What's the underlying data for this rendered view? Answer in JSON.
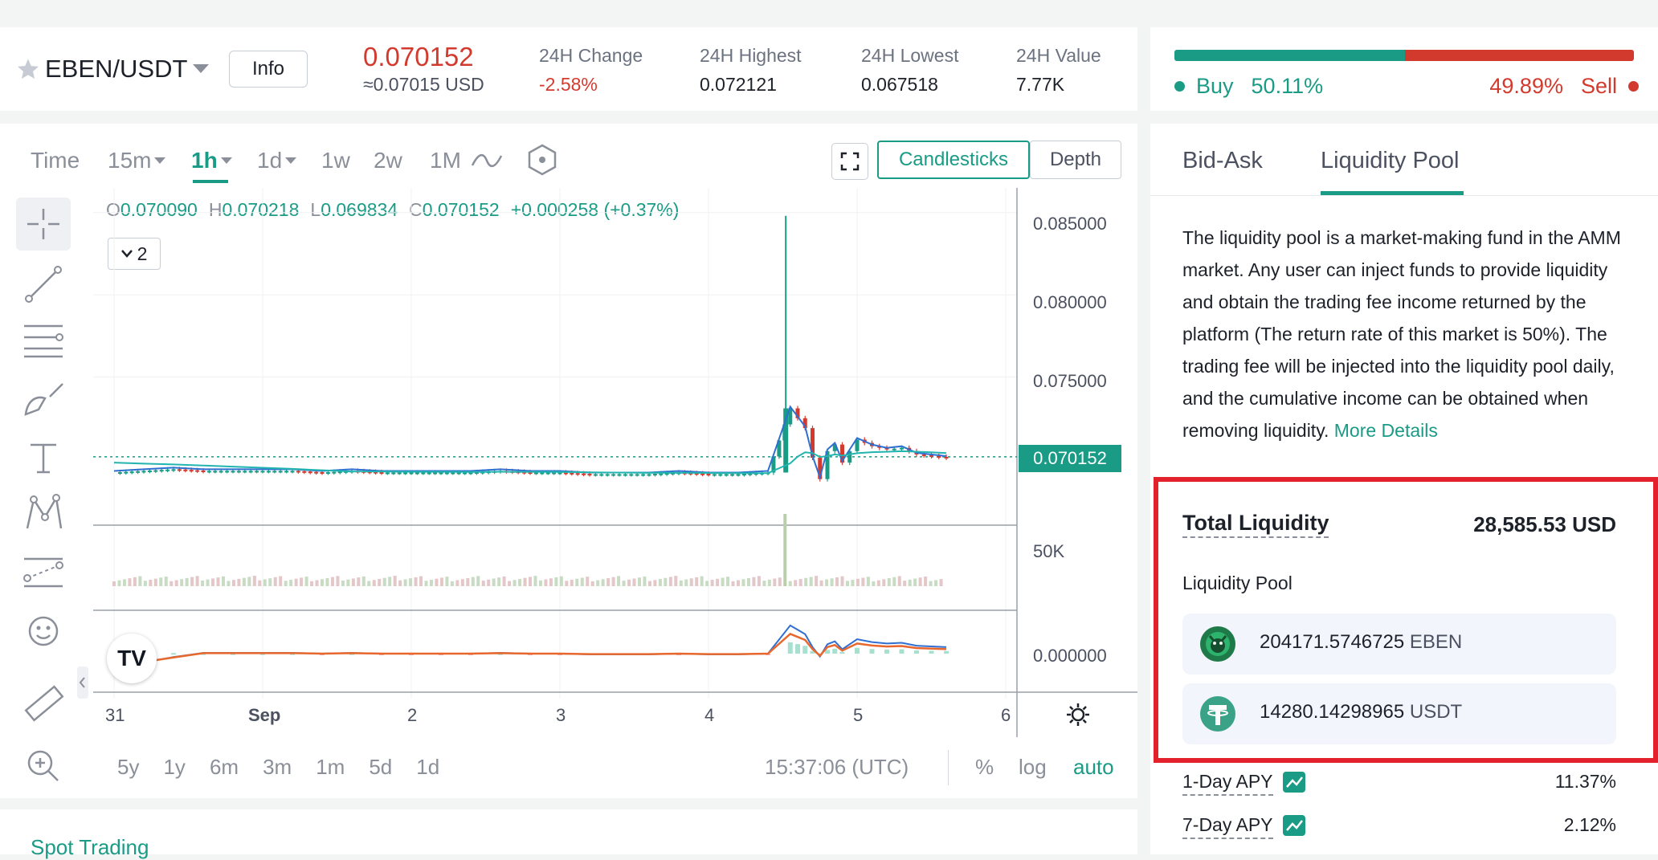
{
  "ticker": {
    "pair": "EBEN/USDT",
    "info_label": "Info",
    "price": "0.070152",
    "price_usd": "≈0.07015 USD",
    "stats": [
      {
        "label": "24H Change",
        "value": "-2.58%"
      },
      {
        "label": "24H Highest",
        "value": "0.072121"
      },
      {
        "label": "24H Lowest",
        "value": "0.067518"
      },
      {
        "label": "24H Value",
        "value": "7.77K"
      }
    ]
  },
  "buysell": {
    "buy_label": "Buy",
    "buy_pct": "50.11%",
    "sell_pct": "49.89%",
    "sell_label": "Sell",
    "buy_fraction": 0.5011,
    "buy_color": "#1a9b86",
    "sell_color": "#d33a2e"
  },
  "chart_toolbar": {
    "time_label": "Time",
    "timeframes": [
      "15m",
      "1h",
      "1d",
      "1w",
      "2w",
      "1M"
    ],
    "active_timeframe": "1h",
    "candlesticks_label": "Candlesticks",
    "depth_label": "Depth"
  },
  "ohlc": {
    "o_label": "O",
    "o": "0.070090",
    "h_label": "H",
    "h": "0.070218",
    "l_label": "L",
    "l": "0.069834",
    "c_label": "C",
    "c": "0.070152",
    "change": "+0.000258 (+0.37%)",
    "indicator_count": "2"
  },
  "chart_data": {
    "type": "line",
    "title": "",
    "y_ticks": [
      "0.085000",
      "0.080000",
      "0.075000"
    ],
    "current_price_label": "0.070152",
    "volume_tick": "50K",
    "macd_tick": "0.000000",
    "x_ticks": [
      "31",
      "Sep",
      "2",
      "3",
      "4",
      "5",
      "6"
    ],
    "ylim": [
      0.066,
      0.0865
    ],
    "series": [
      {
        "name": "",
        "x": [
          0,
          0.2,
          0.4,
          0.6,
          0.8,
          1.0,
          1.2,
          1.4,
          1.6,
          1.8,
          2.0,
          2.2,
          2.4,
          2.6,
          2.8,
          3.0,
          3.2,
          3.4,
          3.6,
          3.8,
          4.0,
          4.2,
          4.4,
          4.55,
          4.6,
          4.65,
          4.7,
          4.75,
          4.8,
          4.85,
          4.9,
          5.0,
          5.1,
          5.2,
          5.3,
          5.4,
          5.5,
          5.6
        ],
        "values": [
          0.0692,
          0.0693,
          0.0694,
          0.0693,
          0.0693,
          0.0693,
          0.0693,
          0.0692,
          0.0693,
          0.0692,
          0.0692,
          0.0692,
          0.0692,
          0.0693,
          0.0692,
          0.0692,
          0.0691,
          0.0691,
          0.0691,
          0.0692,
          0.0691,
          0.0691,
          0.0692,
          0.0731,
          0.0725,
          0.0719,
          0.0701,
          0.0688,
          0.0705,
          0.0709,
          0.0698,
          0.0712,
          0.0708,
          0.0706,
          0.0707,
          0.0703,
          0.0702,
          0.0701
        ]
      }
    ],
    "spike": {
      "x": 4.52,
      "high": 0.0848,
      "low": 0.0692
    }
  },
  "chart_footer": {
    "ranges": [
      "5y",
      "1y",
      "6m",
      "3m",
      "1m",
      "5d",
      "1d"
    ],
    "time": "15:37:06 (UTC)",
    "pct_label": "%",
    "log_label": "log",
    "auto_label": "auto"
  },
  "right_panel": {
    "tabs": [
      "Bid-Ask",
      "Liquidity Pool"
    ],
    "active_tab": "Liquidity Pool",
    "description": "The liquidity pool is a market-making fund in the AMM market. Any user can inject funds to provide liquidity and obtain the trading fee income returned by the platform (The return rate of this market is 50%). The trading fee will be injected into the liquidity pool daily, and the cumulative income can be obtained when removing liquidity.",
    "more_details": "More Details",
    "total_liquidity_label": "Total Liquidity",
    "total_liquidity_value": "28,585.53 USD",
    "pool_label": "Liquidity Pool",
    "tokens": [
      {
        "amount": "204171.5746725",
        "symbol": "EBEN",
        "icon": "eben-token-icon"
      },
      {
        "amount": "14280.14298965",
        "symbol": "USDT",
        "icon": "usdt-token-icon"
      }
    ],
    "apy": [
      {
        "label": "1-Day APY",
        "value": "11.37%"
      },
      {
        "label": "7-Day APY",
        "value": "2.12%"
      }
    ]
  },
  "spot": {
    "label": "Spot Trading"
  }
}
